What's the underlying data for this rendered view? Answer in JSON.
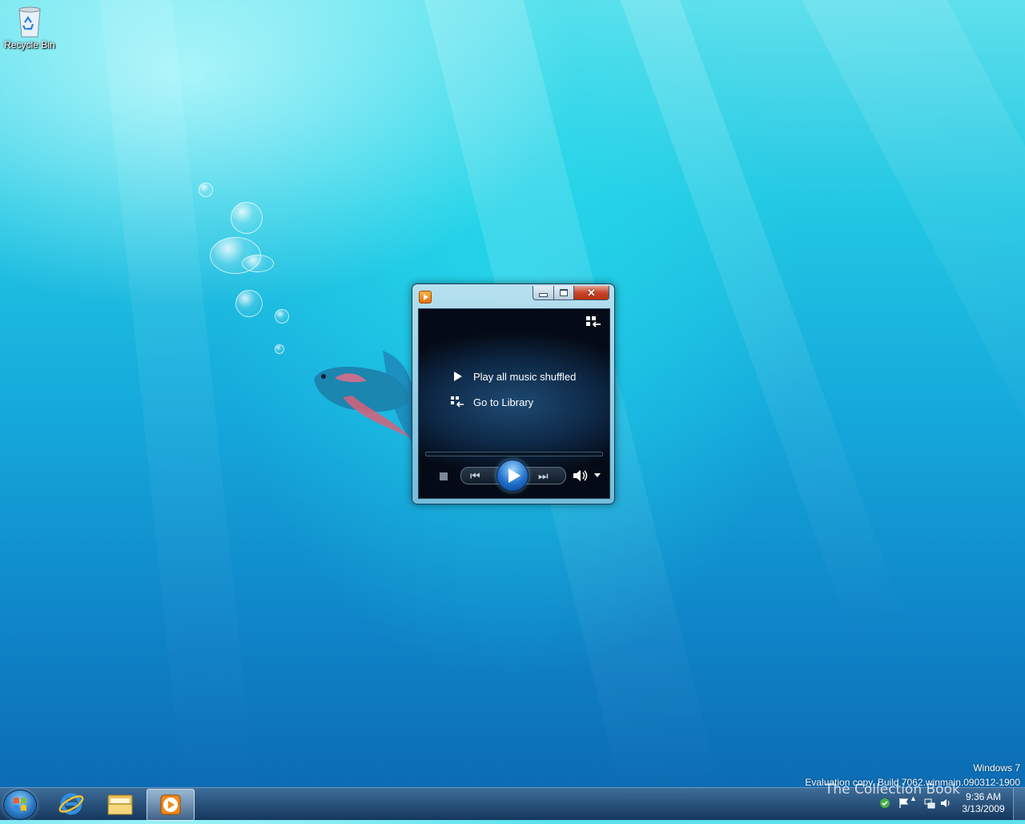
{
  "desktop": {
    "icons": [
      {
        "label": "Recycle Bin",
        "icon": "recycle-bin-icon"
      }
    ],
    "watermark": {
      "line1": "Windows 7",
      "line2": "Evaluation copy. Build 7062.winmain.090312-1900"
    },
    "overlay_brand": "The Collection Book"
  },
  "wmp": {
    "app_icon": "windows-media-player-icon",
    "menu": {
      "play_all": "Play all music shuffled",
      "go_library": "Go to Library"
    },
    "controls": {
      "stop": "stop-icon",
      "prev": "⏮",
      "play": "play-icon",
      "next": "⏭",
      "volume": "speaker-icon"
    },
    "accent": "#1e6fc9"
  },
  "taskbar": {
    "pinned": [
      {
        "name": "start-orb",
        "icon": "windows-logo-icon"
      },
      {
        "name": "internet-explorer",
        "icon": "internet-explorer-icon"
      },
      {
        "name": "windows-explorer",
        "icon": "folder-icon"
      },
      {
        "name": "windows-media-player",
        "icon": "media-player-icon",
        "active": true
      }
    ],
    "clock": {
      "time": "9:36 AM",
      "date": "3/13/2009"
    }
  }
}
